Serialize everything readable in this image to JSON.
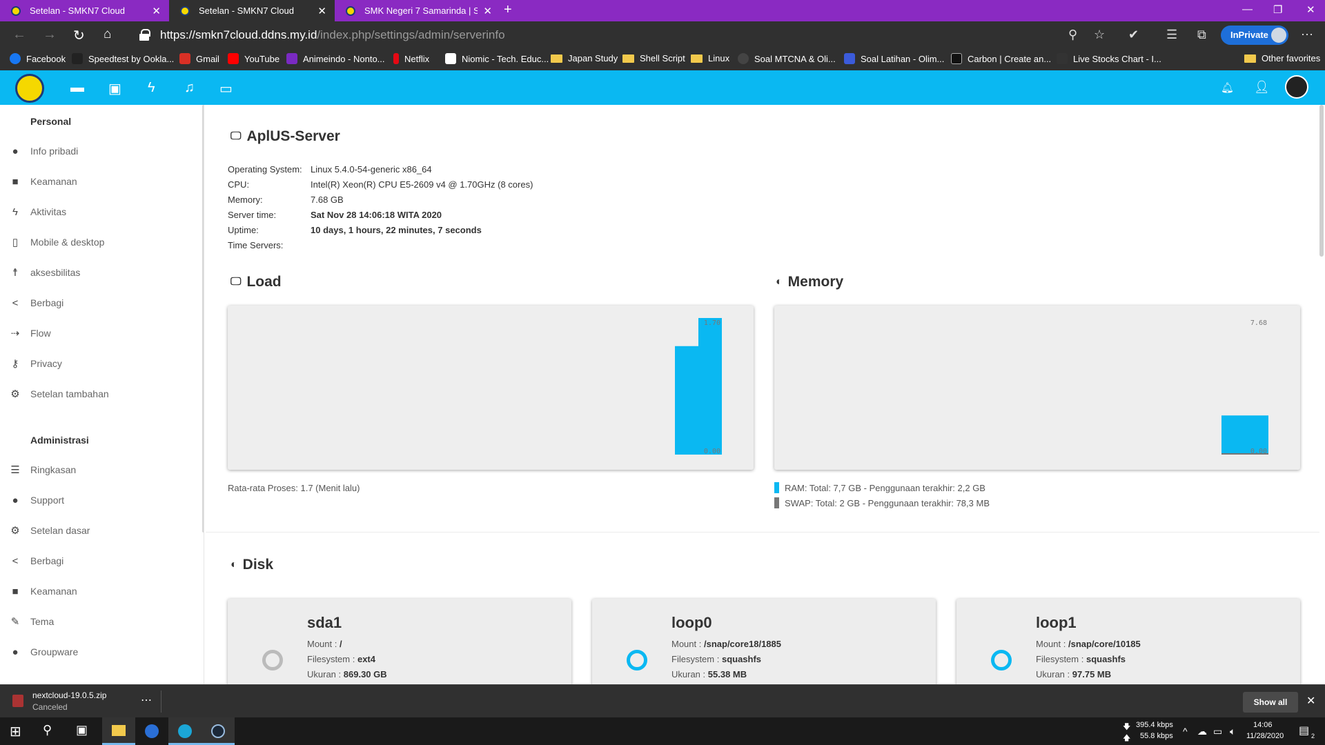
{
  "browser": {
    "tabs": [
      {
        "title": "Setelan - SMKN7 Cloud",
        "active": false
      },
      {
        "title": "Setelan - SMKN7 Cloud",
        "active": true
      },
      {
        "title": "SMK Negeri 7 Samarinda | Selam",
        "active": false
      }
    ],
    "url_host": "https://smkn7cloud.ddns.my.id",
    "url_path": "/index.php/settings/admin/serverinfo",
    "inprivate_label": "InPrivate",
    "favorites": [
      {
        "label": "Facebook",
        "color": "#1877f2"
      },
      {
        "label": "Speedtest by Ookla...",
        "color": "#222222"
      },
      {
        "label": "Gmail",
        "color": "#d93025"
      },
      {
        "label": "YouTube",
        "color": "#ff0000"
      },
      {
        "label": "Animeindo - Nonto...",
        "color": "#7a2ac2"
      },
      {
        "label": "Netflix",
        "color": "#e50914"
      },
      {
        "label": "Niomic - Tech. Educ...",
        "color": "#ffffff"
      },
      {
        "label": "Japan Study",
        "folder": true
      },
      {
        "label": "Shell Script",
        "folder": true
      },
      {
        "label": "Linux",
        "folder": true
      },
      {
        "label": "Soal MTCNA & Oli...",
        "color": "#444444"
      },
      {
        "label": "Soal Latihan - Olim...",
        "color": "#3b5bdb"
      },
      {
        "label": "Carbon | Create an...",
        "color": "#111111"
      },
      {
        "label": "Live Stocks Chart - I...",
        "color": "#333333"
      }
    ],
    "other_favorites": "Other favorites"
  },
  "sidebar": {
    "personal_title": "Personal",
    "personal_items": [
      {
        "label": "Info pribadi",
        "icon": "user-icon"
      },
      {
        "label": "Keamanan",
        "icon": "lock-icon"
      },
      {
        "label": "Aktivitas",
        "icon": "lightning-icon"
      },
      {
        "label": "Mobile & desktop",
        "icon": "phone-icon"
      },
      {
        "label": "aksesbilitas",
        "icon": "accessibility-icon"
      },
      {
        "label": "Berbagi",
        "icon": "share-icon"
      },
      {
        "label": "Flow",
        "icon": "flow-icon"
      },
      {
        "label": "Privacy",
        "icon": "key-icon"
      },
      {
        "label": "Setelan tambahan",
        "icon": "gear-icon"
      }
    ],
    "admin_title": "Administrasi",
    "admin_items": [
      {
        "label": "Ringkasan",
        "icon": "list-icon"
      },
      {
        "label": "Support",
        "icon": "chat-icon"
      },
      {
        "label": "Setelan dasar",
        "icon": "gear-icon"
      },
      {
        "label": "Berbagi",
        "icon": "share-icon"
      },
      {
        "label": "Keamanan",
        "icon": "lock-icon"
      },
      {
        "label": "Tema",
        "icon": "brush-icon"
      },
      {
        "label": "Groupware",
        "icon": "group-icon"
      }
    ]
  },
  "server": {
    "title": "AplUS-Server",
    "rows": [
      {
        "label": "Operating System:",
        "value": "Linux 5.4.0-54-generic x86_64",
        "bold": false
      },
      {
        "label": "CPU:",
        "value": "Intel(R) Xeon(R) CPU E5-2609 v4 @ 1.70GHz (8 cores)",
        "bold": false
      },
      {
        "label": "Memory:",
        "value": "7.68 GB",
        "bold": false
      },
      {
        "label": "Server time:",
        "value": "Sat Nov 28 14:06:18 WITA 2020",
        "bold": true
      },
      {
        "label": "Uptime:",
        "value": "10 days, 1 hours, 22 minutes, 7 seconds",
        "bold": true
      },
      {
        "label": "Time Servers:",
        "value": "",
        "bold": false
      }
    ]
  },
  "load": {
    "title": "Load",
    "caption": "Rata-rata Proses: 1.7 (Menit lalu)"
  },
  "memory": {
    "title": "Memory",
    "ram_legend": "RAM: Total: 7,7 GB - Penggunaan terakhir: 2,2 GB",
    "swap_legend": "SWAP: Total: 2 GB - Penggunaan terakhir: 78,3 MB"
  },
  "chart_data": [
    {
      "type": "area",
      "title": "Load",
      "ylim": [
        0,
        1.7
      ],
      "tick_labels": [
        "1.70",
        "0.00"
      ],
      "x": [
        1,
        2,
        3,
        4
      ],
      "values": [
        1.35,
        1.35,
        1.7,
        1.7
      ],
      "color": "#0ab8f2"
    },
    {
      "type": "area",
      "title": "Memory",
      "ylim": [
        0,
        7.68
      ],
      "tick_labels": [
        "7.68",
        "0.00"
      ],
      "series": [
        {
          "x": [
            1,
            2
          ],
          "values": [
            2.2,
            2.2
          ],
          "color": "#0ab8f2"
        },
        {
          "x": [
            1,
            2
          ],
          "values": [
            0.08,
            0.08
          ],
          "color": "#777777"
        }
      ]
    }
  ],
  "disk": {
    "title": "Disk",
    "mount_label": "Mount :",
    "fs_label": "Filesystem :",
    "size_label": "Ukuran :",
    "items": [
      {
        "name": "sda1",
        "mount": "/",
        "fs": "ext4",
        "size": "869.30 GB",
        "ring_color": "#bbbbbb"
      },
      {
        "name": "loop0",
        "mount": "/snap/core18/1885",
        "fs": "squashfs",
        "size": "55.38 MB",
        "ring_color": "#0ab8f2"
      },
      {
        "name": "loop1",
        "mount": "/snap/core/10185",
        "fs": "squashfs",
        "size": "97.75 MB",
        "ring_color": "#0ab8f2"
      }
    ]
  },
  "download": {
    "filename": "nextcloud-19.0.5.zip",
    "status": "Canceled",
    "show_all": "Show all"
  },
  "taskbar": {
    "net_down": "395.4 kbps",
    "net_up": "55.8 kbps",
    "time": "14:06",
    "date": "11/28/2020",
    "notif_count": "2"
  }
}
